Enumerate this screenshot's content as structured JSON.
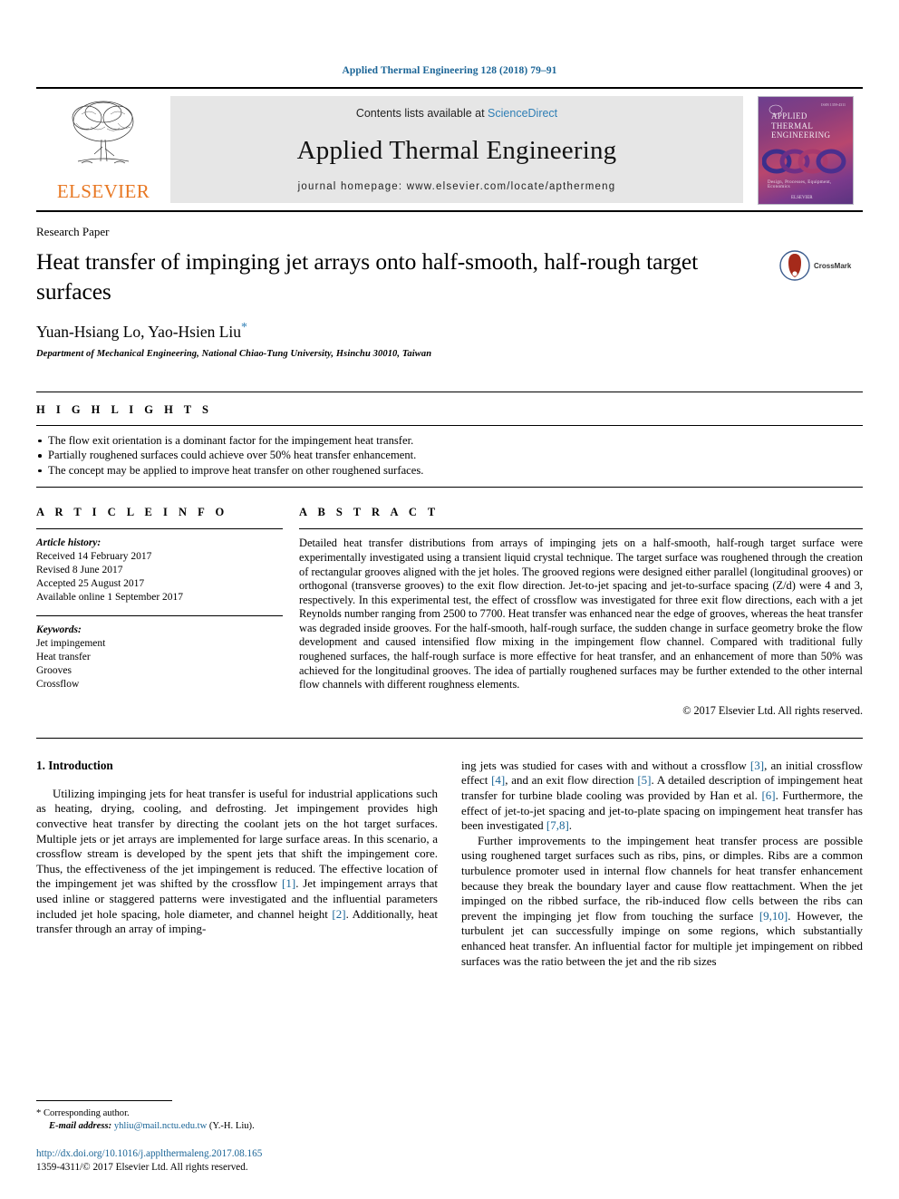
{
  "running_head": "Applied Thermal Engineering 128 (2018) 79–91",
  "banner": {
    "contents_prefix": "Contents lists available at ",
    "sciencedirect": "ScienceDirect",
    "journal_title": "Applied Thermal Engineering",
    "homepage": "journal homepage: www.elsevier.com/locate/apthermeng",
    "publisher_wordmark": "ELSEVIER",
    "cover": {
      "title_line1": "APPLIED",
      "title_line2": "THERMAL",
      "title_line3": "ENGINEERING",
      "footer_text": "Design, Processes, Equipment, Economics",
      "publisher": "ELSEVIER",
      "issn_note": "ISSN 1359-4311"
    }
  },
  "article": {
    "type": "Research Paper",
    "title": "Heat transfer of impinging jet arrays onto half-smooth, half-rough target surfaces",
    "crossmark_label": "CrossMark",
    "authors": "Yuan-Hsiang Lo, Yao-Hsien Liu",
    "author_star": "*",
    "affiliation": "Department of Mechanical Engineering, National Chiao-Tung University, Hsinchu 30010, Taiwan"
  },
  "highlights": {
    "heading": "H I G H L I G H T S",
    "items": [
      "The flow exit orientation is a dominant factor for the impingement heat transfer.",
      "Partially roughened surfaces could achieve over 50% heat transfer enhancement.",
      "The concept may be applied to improve heat transfer on other roughened surfaces."
    ]
  },
  "article_info": {
    "heading": "A R T I C L E   I N F O",
    "history_label": "Article history:",
    "history": [
      "Received 14 February 2017",
      "Revised 8 June 2017",
      "Accepted 25 August 2017",
      "Available online 1 September 2017"
    ],
    "keywords_label": "Keywords:",
    "keywords": [
      "Jet impingement",
      "Heat transfer",
      "Grooves",
      "Crossflow"
    ]
  },
  "abstract": {
    "heading": "A B S T R A C T",
    "text": "Detailed heat transfer distributions from arrays of impinging jets on a half-smooth, half-rough target surface were experimentally investigated using a transient liquid crystal technique. The target surface was roughened through the creation of rectangular grooves aligned with the jet holes. The grooved regions were designed either parallel (longitudinal grooves) or orthogonal (transverse grooves) to the exit flow direction. Jet-to-jet spacing and jet-to-surface spacing (Z/d) were 4 and 3, respectively. In this experimental test, the effect of crossflow was investigated for three exit flow directions, each with a jet Reynolds number ranging from 2500 to 7700. Heat transfer was enhanced near the edge of grooves, whereas the heat transfer was degraded inside grooves. For the half-smooth, half-rough surface, the sudden change in surface geometry broke the flow development and caused intensified flow mixing in the impingement flow channel. Compared with traditional fully roughened surfaces, the half-rough surface is more effective for heat transfer, and an enhancement of more than 50% was achieved for the longitudinal grooves. The idea of partially roughened surfaces may be further extended to the other internal flow channels with different roughness elements.",
    "copyright": "© 2017 Elsevier Ltd. All rights reserved."
  },
  "body": {
    "section_title": "1. Introduction",
    "left_paragraphs": [
      "Utilizing impinging jets for heat transfer is useful for industrial applications such as heating, drying, cooling, and defrosting. Jet impingement provides high convective heat transfer by directing the coolant jets on the hot target surfaces. Multiple jets or jet arrays are implemented for large surface areas. In this scenario, a crossflow stream is developed by the spent jets that shift the impingement core. Thus, the effectiveness of the jet impingement is reduced. The effective location of the impingement jet was shifted by the crossflow [1]. Jet impingement arrays that used inline or staggered patterns were investigated and the influential parameters included jet hole spacing, hole diameter, and channel height [2]. Additionally, heat transfer through an array of imping-"
    ],
    "right_paragraphs": [
      "ing jets was studied for cases with and without a crossflow [3], an initial crossflow effect [4], and an exit flow direction [5]. A detailed description of impingement heat transfer for turbine blade cooling was provided by Han et al. [6]. Furthermore, the effect of jet-to-jet spacing and jet-to-plate spacing on impingement heat transfer has been investigated [7,8].",
      "Further improvements to the impingement heat transfer process are possible using roughened target surfaces such as ribs, pins, or dimples. Ribs are a common turbulence promoter used in internal flow channels for heat transfer enhancement because they break the boundary layer and cause flow reattachment. When the jet impinged on the ribbed surface, the rib-induced flow cells between the ribs can prevent the impinging jet flow from touching the surface [9,10]. However, the turbulent jet can successfully impinge on some regions, which substantially enhanced heat transfer. An influential factor for multiple jet impingement on ribbed surfaces was the ratio between the jet and the rib sizes"
    ]
  },
  "footnote": {
    "corresponding_marker": "*",
    "corresponding_text": "Corresponding author.",
    "email_label": "E-mail address:",
    "email": "yhliu@mail.nctu.edu.tw",
    "email_owner": "(Y.-H. Liu).",
    "doi_url": "http://dx.doi.org/10.1016/j.applthermaleng.2017.08.165",
    "issn_line": "1359-4311/© 2017 Elsevier Ltd. All rights reserved."
  },
  "colors": {
    "link_blue": "#1a6496",
    "sciencedirect_blue": "#2e7eb5",
    "elsevier_orange": "#e87722",
    "banner_gray": "#e6e6e6"
  }
}
